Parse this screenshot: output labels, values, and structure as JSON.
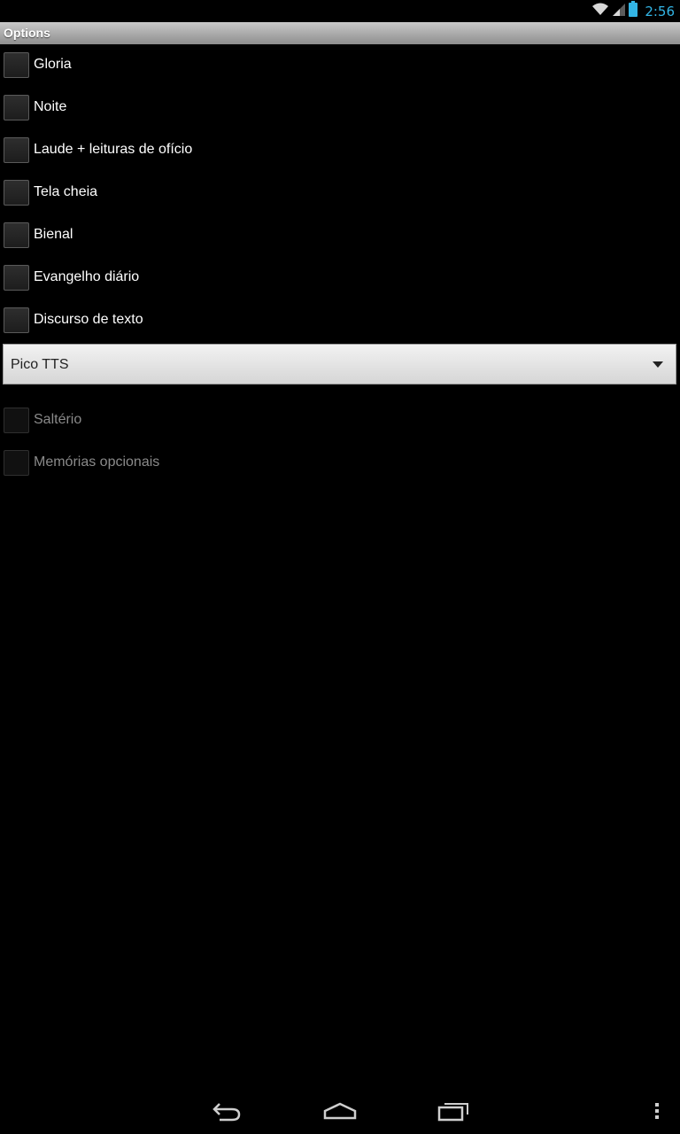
{
  "status_bar": {
    "time": "2:56",
    "icons": [
      "wifi-icon",
      "signal-icon",
      "battery-icon"
    ],
    "accent_color": "#33b5e5"
  },
  "title_bar": {
    "title": "Options"
  },
  "options": [
    {
      "label": "Gloria",
      "checked": false,
      "enabled": true
    },
    {
      "label": "Noite",
      "checked": false,
      "enabled": true
    },
    {
      "label": "Laude + leituras de ofício",
      "checked": false,
      "enabled": true
    },
    {
      "label": "Tela cheia",
      "checked": false,
      "enabled": true
    },
    {
      "label": "Bienal",
      "checked": false,
      "enabled": true
    },
    {
      "label": "Evangelho diário",
      "checked": false,
      "enabled": true
    },
    {
      "label": "Discurso de texto",
      "checked": false,
      "enabled": true
    }
  ],
  "tts_spinner": {
    "selected": "Pico TTS",
    "icon": "dropdown-arrow-icon"
  },
  "disabled_options": [
    {
      "label": "Saltério",
      "checked": false,
      "enabled": false
    },
    {
      "label": "Memórias opcionais",
      "checked": false,
      "enabled": false
    }
  ],
  "nav_bar": {
    "icons": [
      "back-icon",
      "home-icon",
      "recent-apps-icon",
      "overflow-menu-icon"
    ]
  }
}
